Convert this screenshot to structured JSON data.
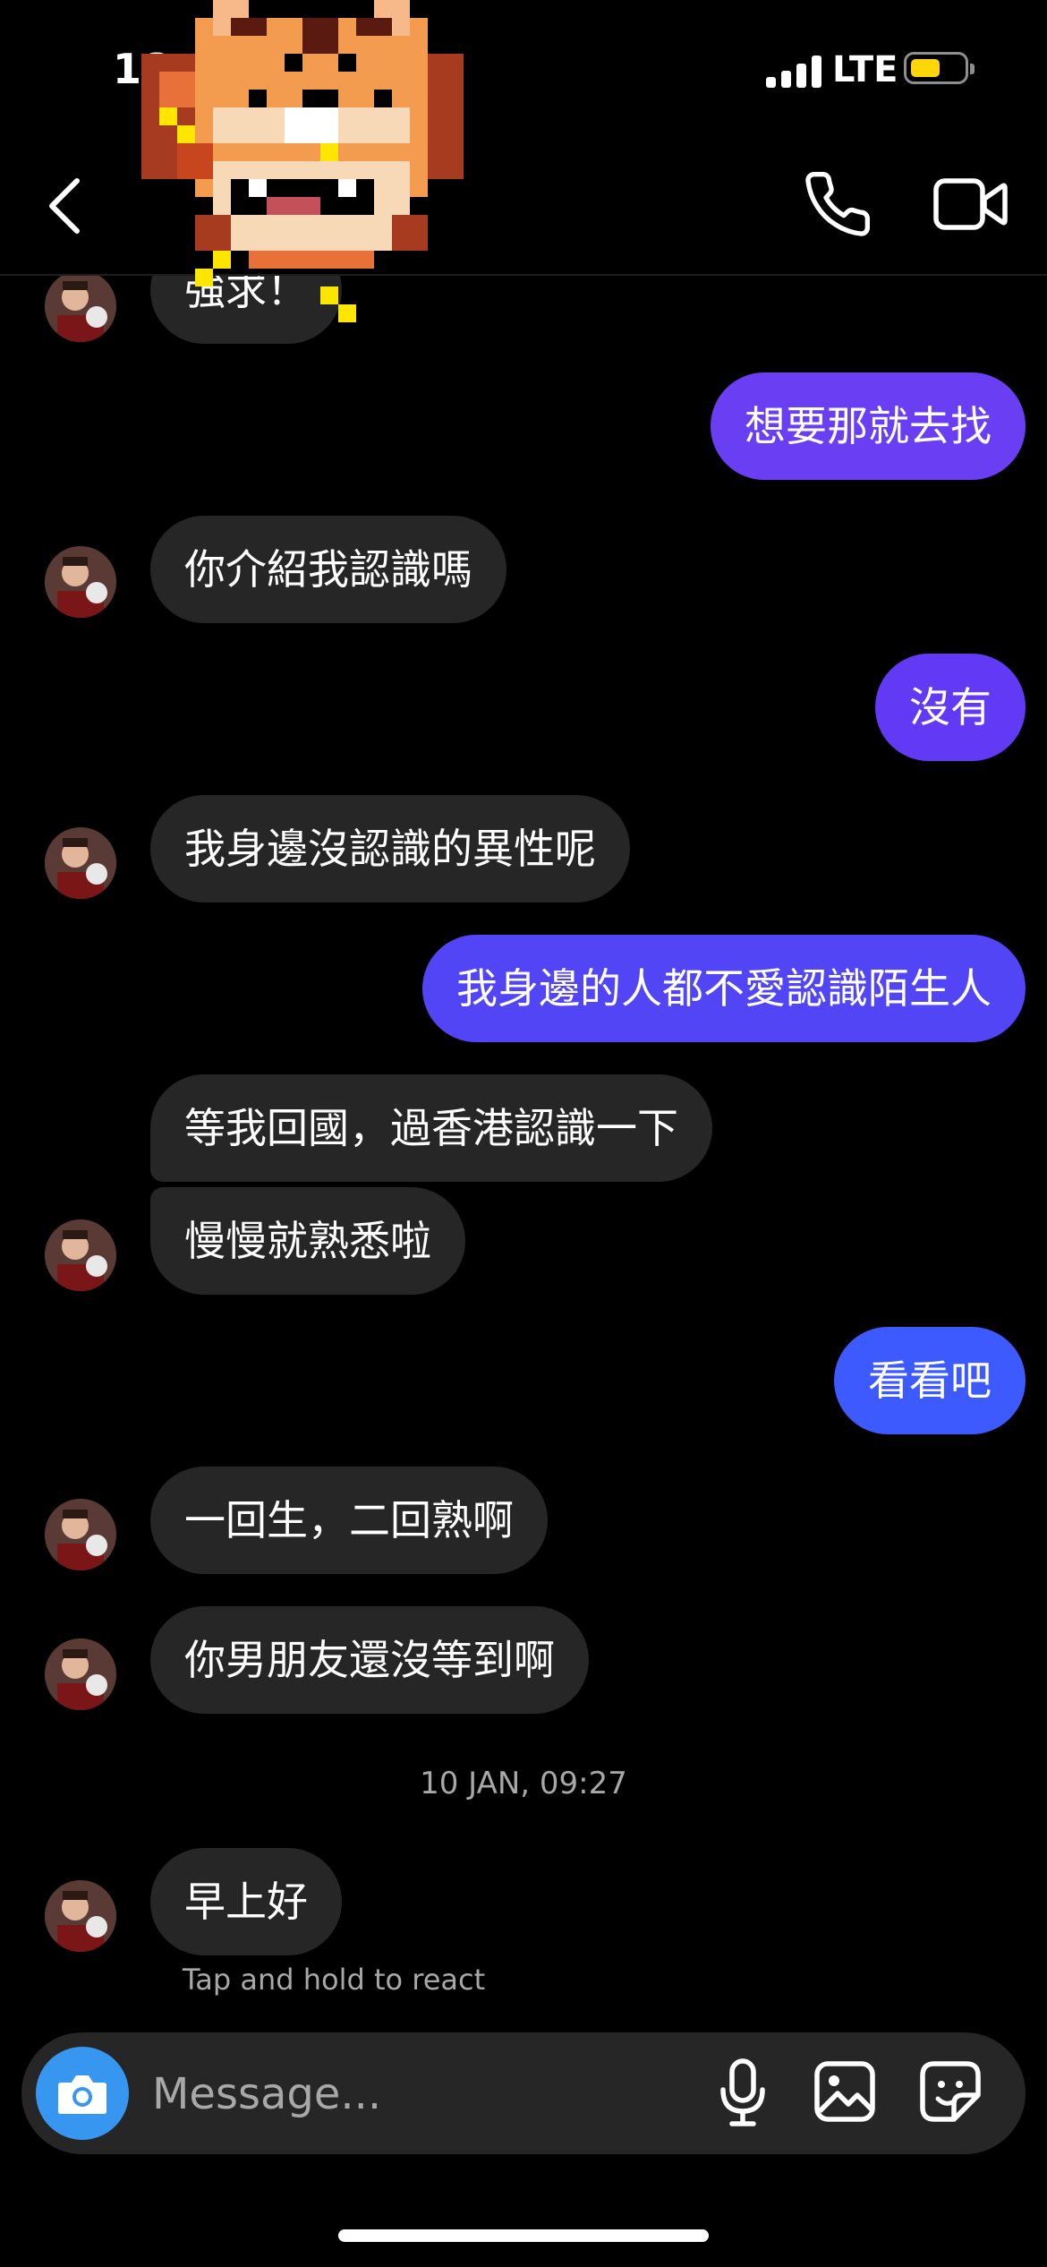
{
  "status_bar": {
    "time": "18",
    "network": "LTE"
  },
  "icons": {
    "back": "chevron-left-icon",
    "call": "phone-icon",
    "video": "video-camera-icon",
    "camera": "camera-icon",
    "mic": "microphone-icon",
    "gallery": "image-icon",
    "sticker": "sticker-icon"
  },
  "colors": {
    "outgoing_purple": "#6a3ef2",
    "outgoing_blue": "#3d5afe",
    "incoming": "#262626",
    "camera_button": "#3797f0",
    "battery": "#ffd60a"
  },
  "messages": [
    {
      "from": "them",
      "text": "強求！"
    },
    {
      "from": "me",
      "text": "想要那就去找"
    },
    {
      "from": "them",
      "text": "你介紹我認識嗎"
    },
    {
      "from": "me",
      "text": "沒有"
    },
    {
      "from": "them",
      "text": "我身邊沒認識的異性呢"
    },
    {
      "from": "me",
      "text": "我身邊的人都不愛認識陌生人"
    },
    {
      "from": "them",
      "text": "等我回國，過香港認識一下"
    },
    {
      "from": "them",
      "text": "慢慢就熟悉啦"
    },
    {
      "from": "me",
      "text": "看看吧"
    },
    {
      "from": "them",
      "text": "一回生，二回熟啊"
    },
    {
      "from": "them",
      "text": "你男朋友還沒等到啊"
    },
    {
      "from": "them",
      "text": "早上好"
    }
  ],
  "timestamp": "10 JAN, 09:27",
  "react_hint": "Tap and hold to react",
  "composer": {
    "placeholder": "Message..."
  }
}
